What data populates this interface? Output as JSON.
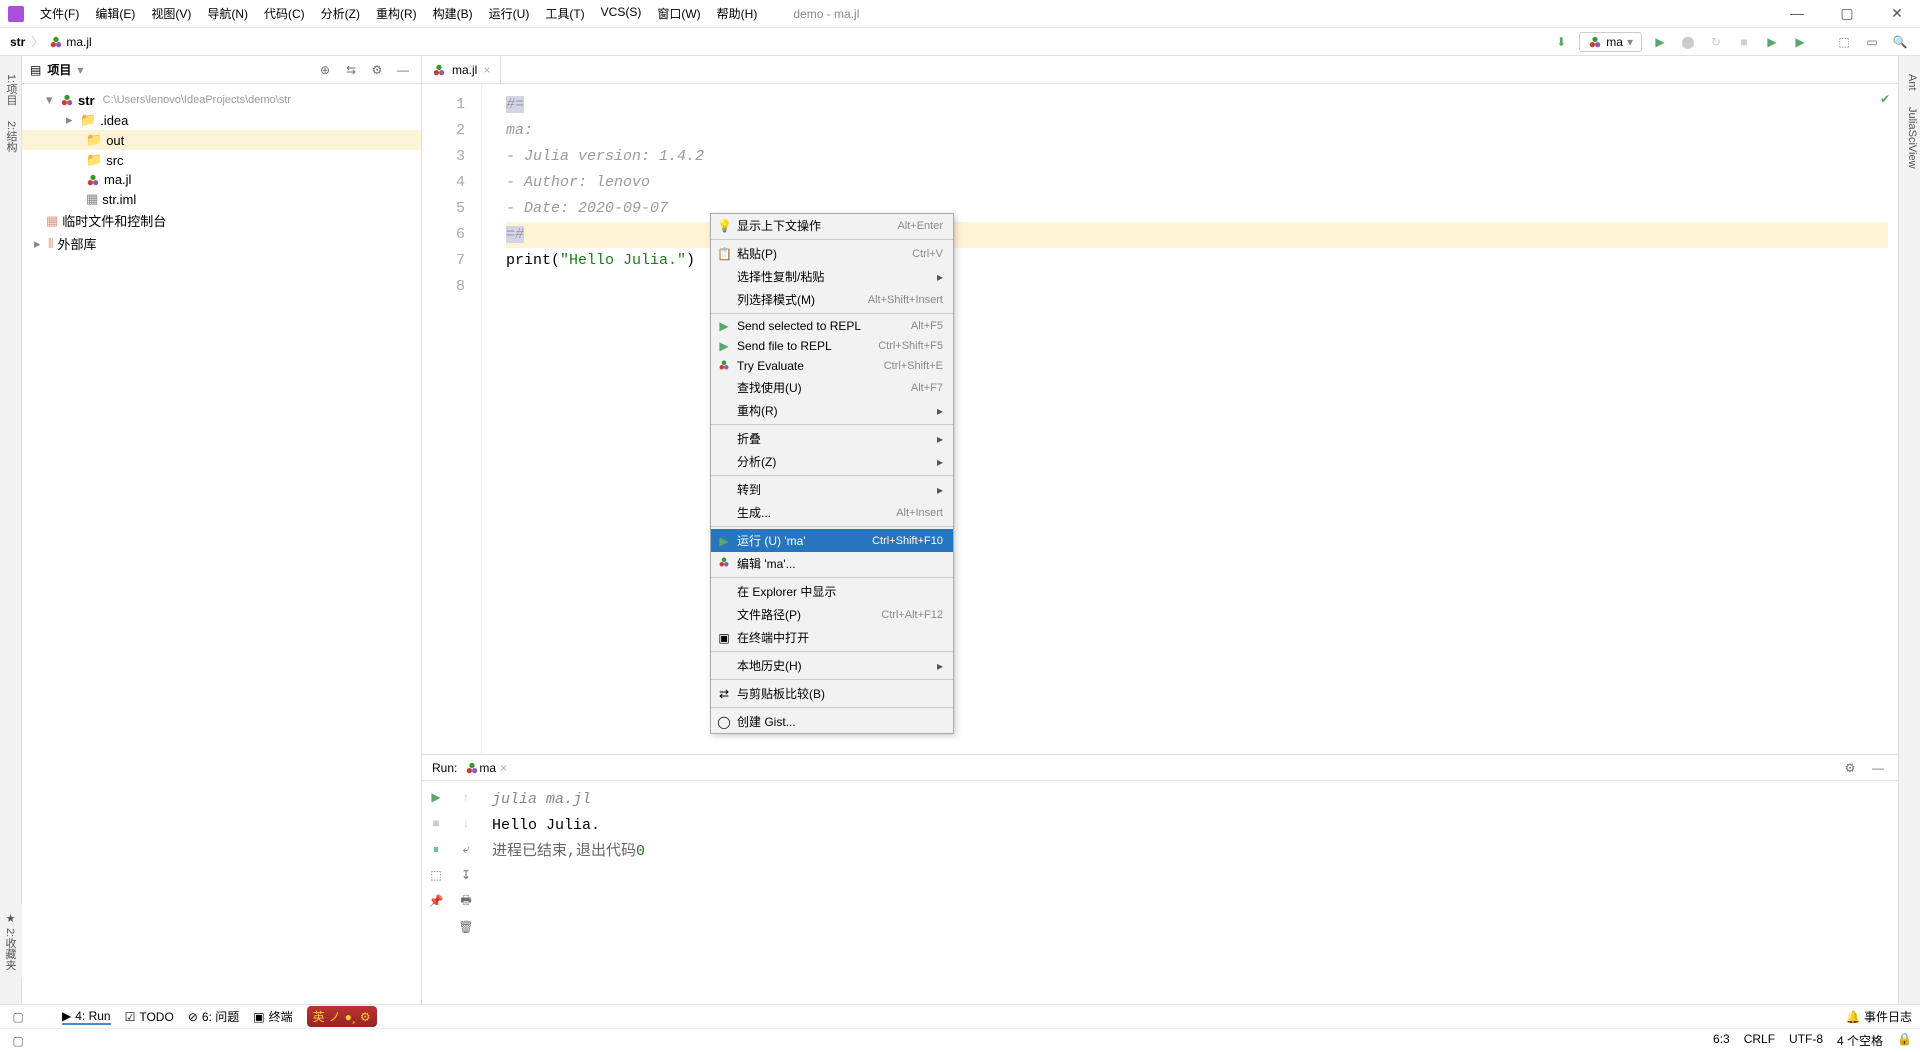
{
  "title": "demo - ma.jl",
  "menu": [
    "文件(F)",
    "编辑(E)",
    "视图(V)",
    "导航(N)",
    "代码(C)",
    "分析(Z)",
    "重构(R)",
    "构建(B)",
    "运行(U)",
    "工具(T)",
    "VCS(S)",
    "窗口(W)",
    "帮助(H)"
  ],
  "breadcrumb": {
    "project": "str",
    "file": "ma.jl"
  },
  "run_config_name": "ma",
  "project_panel_title": "项目",
  "tree": {
    "root": {
      "name": "str",
      "path": "C:\\Users\\lenovo\\IdeaProjects\\demo\\str"
    },
    "children": [
      ".idea",
      "out",
      "src",
      "ma.jl",
      "str.iml"
    ],
    "extra": [
      "临时文件和控制台",
      "外部库"
    ]
  },
  "editor": {
    "tab_name": "ma.jl",
    "lines": [
      {
        "n": 1,
        "text": "#=",
        "cls": "comment highlight-block"
      },
      {
        "n": 2,
        "text": "ma:",
        "cls": "comment"
      },
      {
        "n": 3,
        "text": "- Julia version: 1.4.2",
        "cls": "comment"
      },
      {
        "n": 4,
        "text": "- Author: lenovo",
        "cls": "comment"
      },
      {
        "n": 5,
        "text": "- Date: 2020-09-07",
        "cls": "comment"
      },
      {
        "n": 6,
        "text": "=#",
        "cls": "comment highlight-block current-line-bg"
      },
      {
        "n": 7,
        "text_pre": "print(",
        "string": "\"Hello Julia.\"",
        "text_post": ")"
      },
      {
        "n": 8,
        "text": ""
      }
    ]
  },
  "context_menu": [
    {
      "label": "显示上下文操作",
      "shortcut": "Alt+Enter",
      "icon": "bulb"
    },
    {
      "sep": true
    },
    {
      "label": "粘贴(P)",
      "shortcut": "Ctrl+V",
      "icon": "paste"
    },
    {
      "label": "选择性复制/粘贴",
      "submenu": true
    },
    {
      "label": "列选择模式(M)",
      "shortcut": "Alt+Shift+Insert"
    },
    {
      "sep": true
    },
    {
      "label": "Send selected to REPL",
      "shortcut": "Alt+F5",
      "icon": "play-green"
    },
    {
      "label": "Send file to REPL",
      "shortcut": "Ctrl+Shift+F5",
      "icon": "play-green"
    },
    {
      "label": "Try Evaluate",
      "shortcut": "Ctrl+Shift+E",
      "icon": "julia"
    },
    {
      "label": "查找使用(U)",
      "shortcut": "Alt+F7"
    },
    {
      "label": "重构(R)",
      "submenu": true
    },
    {
      "sep": true
    },
    {
      "label": "折叠",
      "submenu": true
    },
    {
      "label": "分析(Z)",
      "submenu": true
    },
    {
      "sep": true
    },
    {
      "label": "转到",
      "submenu": true
    },
    {
      "label": "生成...",
      "shortcut": "Alt+Insert"
    },
    {
      "sep": true
    },
    {
      "label": "运行 (U) 'ma'",
      "shortcut": "Ctrl+Shift+F10",
      "icon": "play-green",
      "highlighted": true
    },
    {
      "label": "编辑 'ma'...",
      "icon": "julia"
    },
    {
      "sep": true
    },
    {
      "label": "在 Explorer 中显示"
    },
    {
      "label": "文件路径(P)",
      "shortcut": "Ctrl+Alt+F12"
    },
    {
      "label": "在终端中打开",
      "icon": "terminal"
    },
    {
      "sep": true
    },
    {
      "label": "本地历史(H)",
      "submenu": true
    },
    {
      "sep": true
    },
    {
      "label": "与剪贴板比较(B)",
      "icon": "compare"
    },
    {
      "sep": true
    },
    {
      "label": "创建 Gist...",
      "icon": "github"
    }
  ],
  "run_panel": {
    "label": "Run:",
    "config": "ma",
    "lines": [
      {
        "text": "julia ma.jl",
        "cls": "cmd"
      },
      {
        "text": "Hello Julia."
      },
      {
        "text_pre": "进程已结束,退出代码",
        "code": "0",
        "cls": "exit"
      }
    ]
  },
  "bottom_tabs": [
    "4: Run",
    "TODO",
    "6: 问题",
    "终端"
  ],
  "status": {
    "event_log": "事件日志",
    "pos": "6:3",
    "eol": "CRLF",
    "enc": "UTF-8",
    "indent": "4 个空格"
  },
  "left_tabs": [
    "1:项目",
    "2:结构"
  ],
  "right_tabs": [
    "Ant",
    "JuliaSciView"
  ],
  "left_tabs_bottom": [
    "2:收藏夹"
  ]
}
